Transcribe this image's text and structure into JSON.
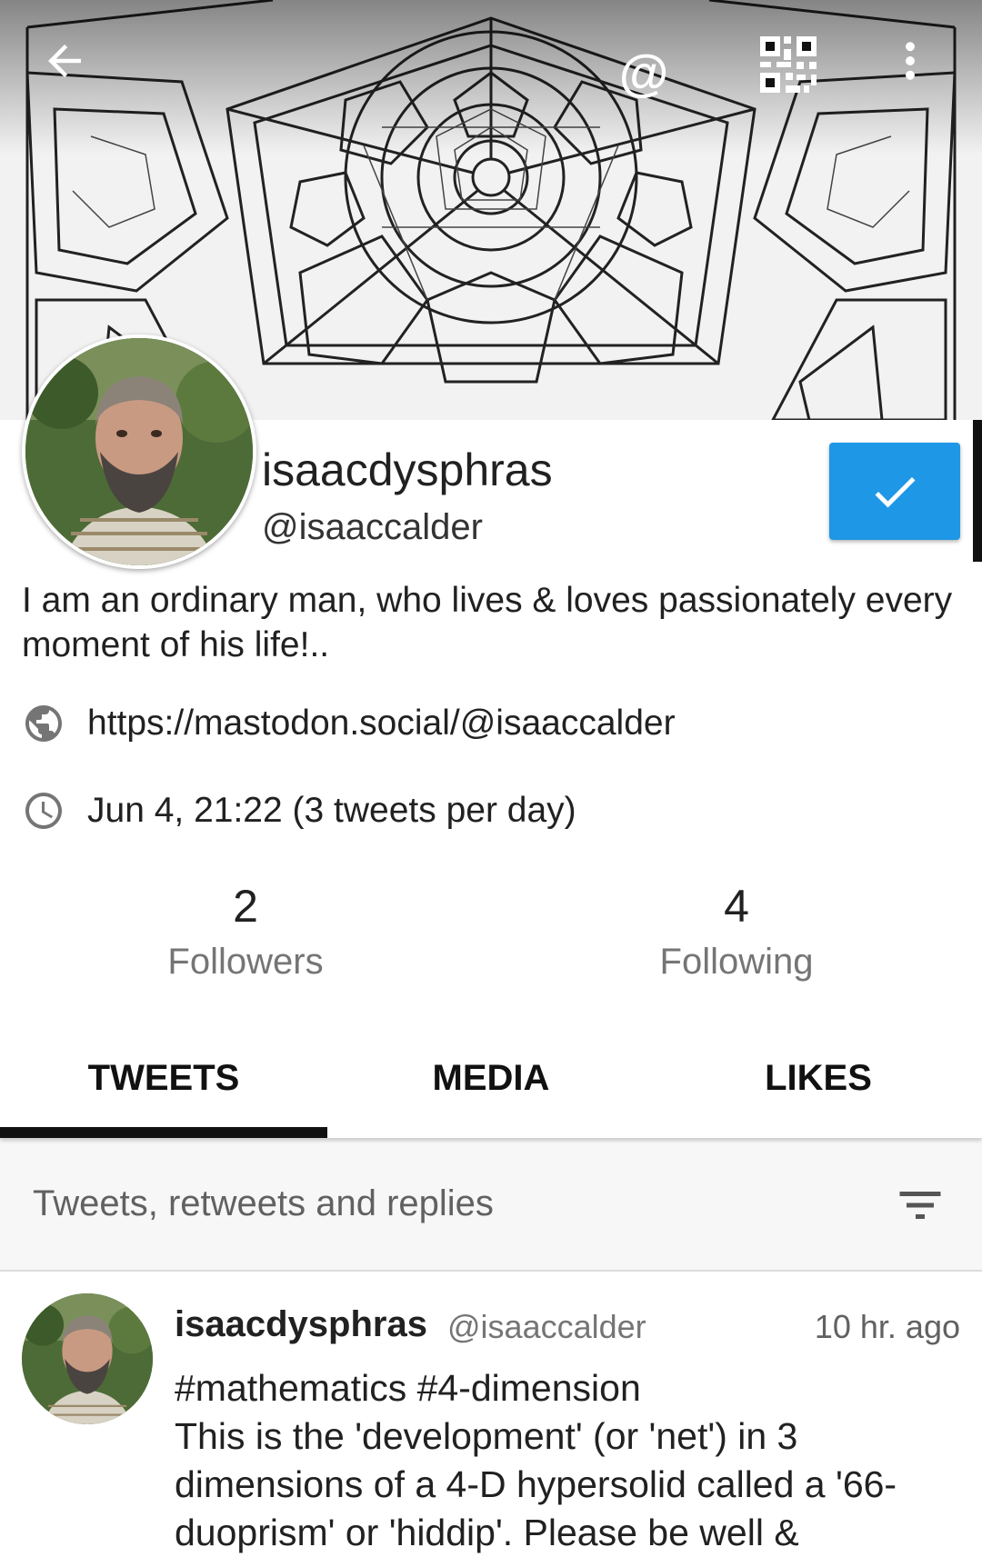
{
  "toolbar": {
    "back_icon": "arrow-left-icon",
    "mention_icon": "at-icon",
    "mention_symbol": "@",
    "qr_icon": "qr-code-icon",
    "more_icon": "more-vert-icon"
  },
  "profile": {
    "display_name": "isaacdysphras",
    "handle": "@isaaccalder",
    "follow_state_icon": "check-icon",
    "follow_color": "#1e97e6",
    "bio": "I am an ordinary man, who lives & loves passionately every moment of his life!..",
    "link": "https://mastodon.social/@isaaccalder",
    "joined": "Jun 4, 21:22 (3 tweets per day)",
    "followers_count": "2",
    "followers_label": "Followers",
    "following_count": "4",
    "following_label": "Following"
  },
  "tabs": [
    {
      "label": "TWEETS",
      "active": true
    },
    {
      "label": "MEDIA",
      "active": false
    },
    {
      "label": "LIKES",
      "active": false
    }
  ],
  "filter": {
    "label": "Tweets, retweets and replies",
    "icon": "filter-list-icon"
  },
  "tweets": [
    {
      "name": "isaacdysphras",
      "handle": "@isaaccalder",
      "time": "10 hr. ago",
      "text": "#mathematics #4-dimension\nThis is the 'development' (or 'net') in 3 dimensions of a 4-D hypersolid called a '66-duoprism' or 'hiddip'. Please be well &"
    }
  ]
}
